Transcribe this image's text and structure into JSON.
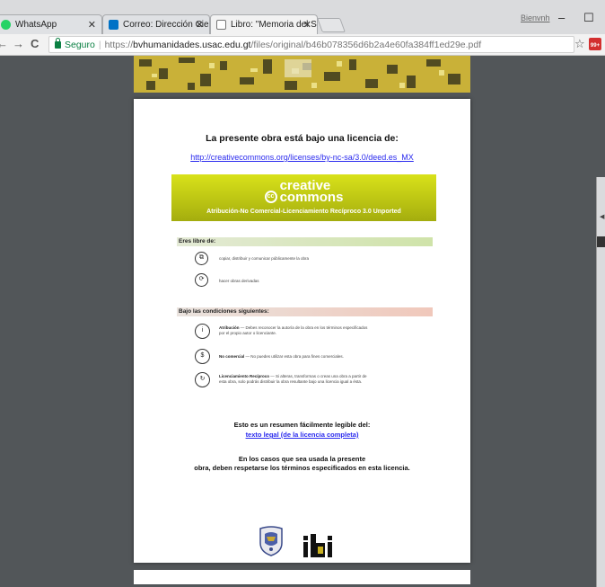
{
  "browser": {
    "tabs": [
      {
        "title": "WhatsApp"
      },
      {
        "title": "Correo: Dirección Cienci"
      },
      {
        "title": "Libro: \"Memoria del Seg"
      }
    ],
    "profile": "Bienvnh",
    "window_minimize": "–",
    "window_maximize": "☐",
    "back": "←",
    "forward": "→",
    "reload": "C",
    "secure_label": "Seguro",
    "url_scheme": "https://",
    "url_host": "bvhumanidades.usac.edu.gt",
    "url_path": "/files/original/b46b078356d6b2a4e60fa384ff1ed29e.pdf",
    "ext_badge": "99+"
  },
  "pdf": {
    "title": "La presente obra está bajo una licencia de:",
    "license_url": "http://creativecommons.org/licenses/by-nc-sa/3.0/deed.es_MX",
    "cc_logo_top": "creative",
    "cc_logo_bottom": "commons",
    "cc_subtitle": "Atribución-No Comercial-Licenciamiento Recíproco 3.0 Unported",
    "free_heading": "Eres libre de:",
    "freedoms": [
      {
        "text": "copiar, distribuir y comunicar públicamente la obra"
      },
      {
        "text": "hacer obras derivadas"
      }
    ],
    "conditions_heading": "Bajo las condiciones siguientes:",
    "conditions": [
      {
        "bold": "Atribución",
        "text": " — Debes reconocer la autoría de la obra en los términos especificados por el propio autor o licenciante."
      },
      {
        "bold": "No comercial",
        "text": " — No puedes utilizar esta obra para fines comerciales."
      },
      {
        "bold": "Licenciamiento Recíproco",
        "text": " — Si alteras, transformas o creas una obra a partir de esta obra, solo podrás distribuir la obra resultante bajo una licencia igual a ésta."
      }
    ],
    "summary_line": "Esto es un resumen fácilmente legible del:",
    "legal_link": "texto legal (de la licencia completa)",
    "closing_line1": "En los casos que sea usada la presente",
    "closing_line2": "obra, deben respetarse los términos especificados en esta licencia."
  }
}
